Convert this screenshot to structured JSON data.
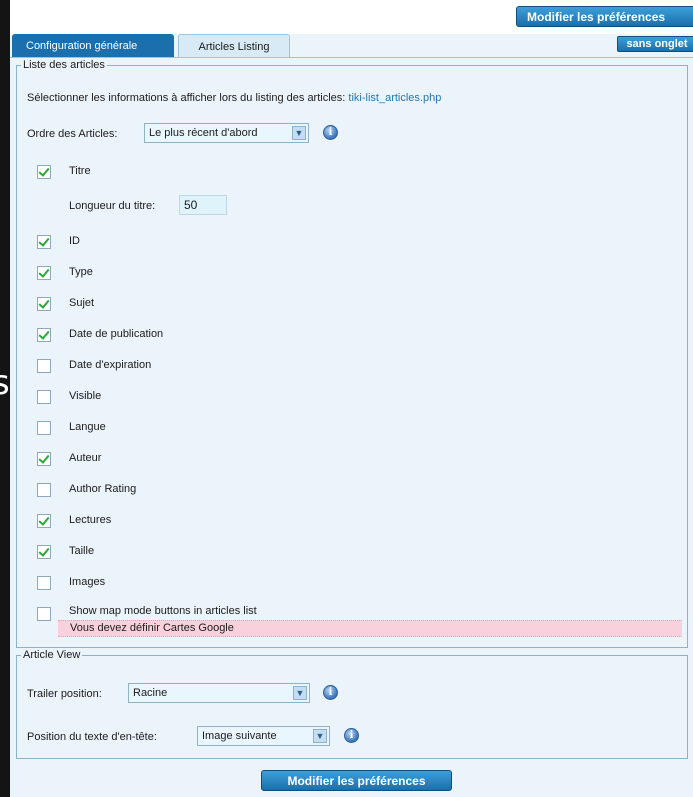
{
  "left_glyph": "s",
  "top_button": "Modifier les préférences",
  "tabs": [
    {
      "label": "Configuration générale"
    },
    {
      "label": "Articles Listing"
    }
  ],
  "no_tabs_button": "sans onglet",
  "list_section": {
    "legend": "Liste des articles",
    "intro": "Sélectionner les informations à afficher lors du listing des articles:",
    "intro_link": "tiki-list_articles.php",
    "order_label": "Ordre des Articles:",
    "order_value": "Le plus récent d'abord",
    "title_length_label": "Longueur du titre:",
    "title_length_value": "50",
    "items": [
      {
        "label": "Titre",
        "checked": true
      },
      {
        "label": "ID",
        "checked": true
      },
      {
        "label": "Type",
        "checked": true
      },
      {
        "label": "Sujet",
        "checked": true
      },
      {
        "label": "Date de publication",
        "checked": true
      },
      {
        "label": "Date d'expiration",
        "checked": false
      },
      {
        "label": "Visible",
        "checked": false
      },
      {
        "label": "Langue",
        "checked": false
      },
      {
        "label": "Auteur",
        "checked": true
      },
      {
        "label": "Author Rating",
        "checked": false
      },
      {
        "label": "Lectures",
        "checked": true
      },
      {
        "label": "Taille",
        "checked": true
      },
      {
        "label": "Images",
        "checked": false
      },
      {
        "label": "Show map mode buttons in articles list",
        "checked": false
      }
    ],
    "warning": "Vous devez définir Cartes Google"
  },
  "view_section": {
    "legend": "Article View",
    "trailer_label": "Trailer position:",
    "trailer_value": "Racine",
    "header_label": "Position du texte d'en-tête:",
    "header_value": "Image suivante"
  },
  "bottom_button": "Modifier les préférences",
  "colors": {
    "accent": "#1a6fac",
    "panel_bg": "#ecf4fb",
    "warning_bg": "#f8d1dc",
    "check": "#2aa836"
  }
}
